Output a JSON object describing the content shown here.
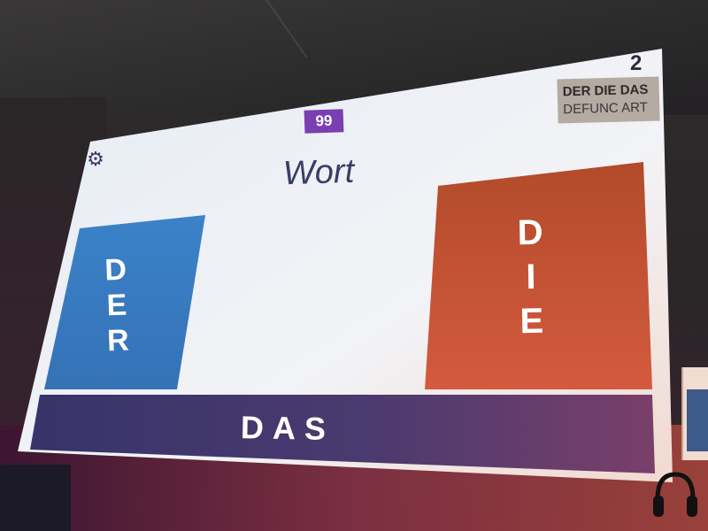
{
  "game": {
    "score": "99",
    "word": "Wort",
    "corner_number": "2",
    "logo": {
      "line1": "DER DIE DAS",
      "line2": "DEFUNC ART"
    },
    "choices": {
      "left": "DER",
      "right": "DIE",
      "bottom": "DAS"
    },
    "settings_icon": "gear-icon"
  },
  "colors": {
    "screen": "#eef0f6",
    "der_blue": "#3f86c9",
    "die_orange": "#c1552e",
    "das_purple": "#3c3566",
    "score_purple": "#7a3fb3",
    "logo_bg": "#b4aba3"
  }
}
